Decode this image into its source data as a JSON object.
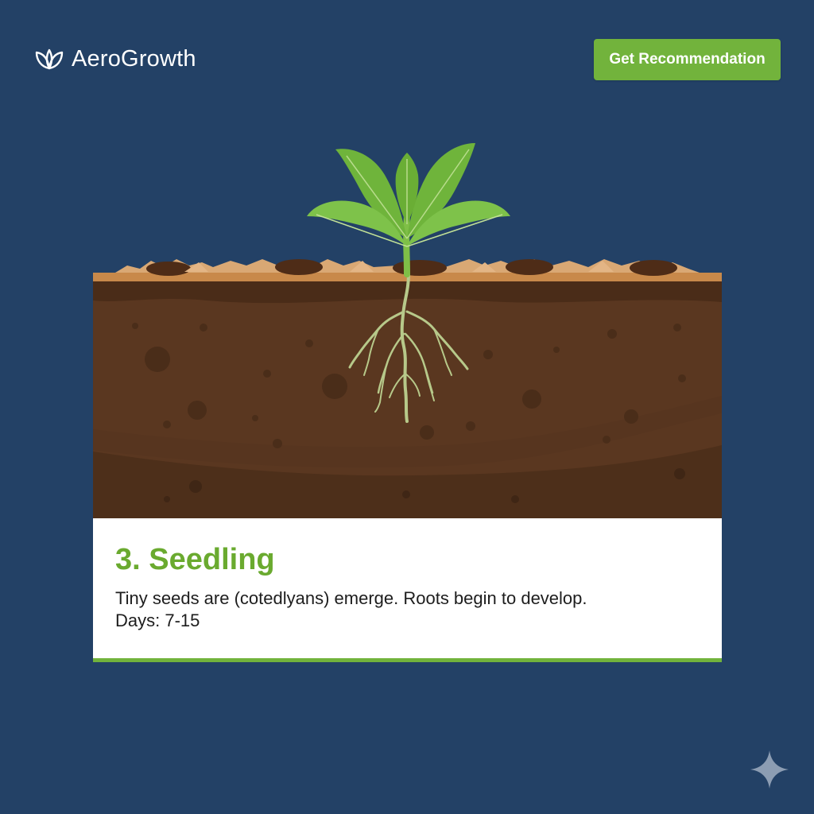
{
  "header": {
    "brand_name": "AeroGrowth",
    "logo_icon": "leaves-icon",
    "cta_label": "Get Recommendation"
  },
  "stage": {
    "title": "3. Seedling",
    "description": "Tiny seeds are (cotedlyans) emerge. Roots begin to develop.",
    "days": "Days: 7-15"
  },
  "illustration": {
    "subject": "seedling-plant-icon"
  },
  "corner": {
    "icon": "sparkle-icon"
  },
  "colors": {
    "background": "#234166",
    "accent": "#72b33c",
    "title_green": "#6aaa2f",
    "soil": "#5a3720"
  }
}
